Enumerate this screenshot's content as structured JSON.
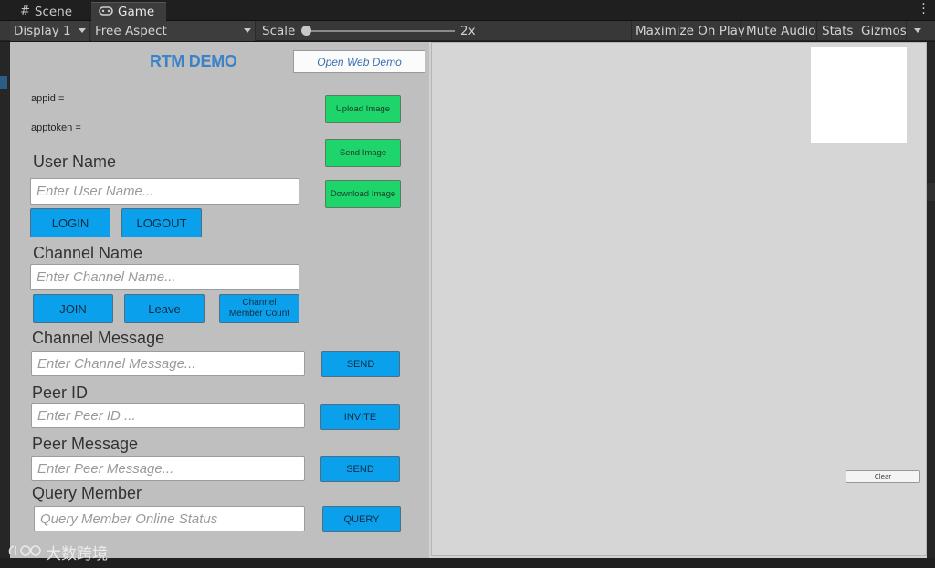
{
  "tabs": [
    {
      "icon": "#",
      "label": "Scene"
    },
    {
      "icon": "gamepad-icon",
      "label": "Game"
    }
  ],
  "toolbar": {
    "display": "Display 1",
    "aspect": "Free Aspect",
    "scale_label": "Scale",
    "scale_value": "2x",
    "scale_slider_level": 0,
    "maximize": "Maximize On Play",
    "mute": "Mute Audio",
    "stats": "Stats",
    "gizmos": "Gizmos"
  },
  "demo": {
    "title": "RTM DEMO",
    "open_web": "Open Web Demo",
    "appid_label": "appid =",
    "apptoken_label": "apptoken =",
    "upload_image": "Upload Image",
    "send_image": "Send Image",
    "download_image": "Download Image",
    "user_name_label": "User Name",
    "user_name_placeholder": "Enter User Name...",
    "login": "LOGIN",
    "logout": "LOGOUT",
    "channel_name_label": "Channel Name",
    "channel_name_placeholder": "Enter Channel Name...",
    "join": "JOIN",
    "leave": "Leave",
    "channel_member_count": "Channel Member Count",
    "channel_message_label": "Channel Message",
    "channel_message_placeholder": "Enter Channel Message...",
    "channel_send": "SEND",
    "peer_id_label": "Peer ID",
    "peer_id_placeholder": "Enter Peer ID ...",
    "invite": "INVITE",
    "peer_message_label": "Peer Message",
    "peer_message_placeholder": "Enter Peer Message...",
    "peer_send": "SEND",
    "query_member_label": "Query Member",
    "query_member_placeholder": "Query Member Online Status",
    "query": "QUERY",
    "clear": "Clear"
  },
  "watermark": {
    "text": "大数跨境"
  },
  "colors": {
    "button_blue": "#0aa0ec",
    "button_green": "#1dd56a",
    "title_blue": "#3b82c6",
    "panel_gray": "#bfbfbf"
  }
}
